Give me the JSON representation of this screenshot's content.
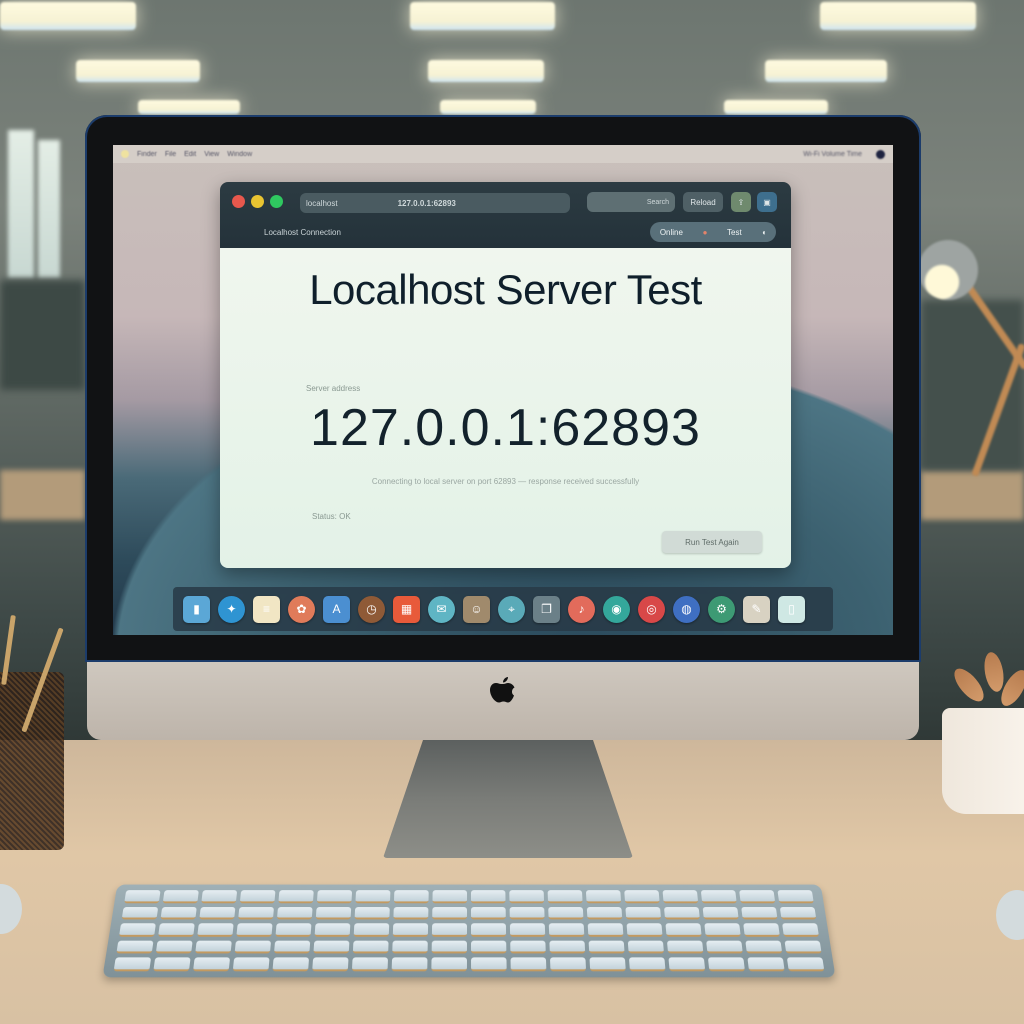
{
  "scene": {
    "description": "iMac on a wooden desk in an office, displaying a browser window"
  },
  "menubar": {
    "left_items": [
      "Finder",
      "File",
      "Edit",
      "View",
      "Window"
    ],
    "right_status": "Wi-Fi  Volume  Time"
  },
  "browser": {
    "traffic_lights": {
      "close": "#e8584d",
      "minimize": "#e9c431",
      "zoom": "#2fc860"
    },
    "url_prefix": "localhost",
    "url_path": "127.0.0.1:62893",
    "search_placeholder": "Search",
    "toolbar_button_label": "Reload",
    "tab_label": "Localhost Connection",
    "pill_text_left": "Online",
    "pill_text_mid": "Test",
    "page": {
      "title": "Localhost Server Test",
      "address_label": "Server address",
      "address": "127.0.0.1:62893",
      "description": "Connecting to local server on port 62893 — response received successfully",
      "status_label": "Status: OK",
      "action_button": "Run Test Again"
    }
  },
  "dock": {
    "icons": [
      {
        "name": "finder-icon",
        "glyph": "▮",
        "color": "#5ba7d6",
        "shape": "sq"
      },
      {
        "name": "safari-icon",
        "glyph": "✦",
        "color": "#2f94d2",
        "shape": "round"
      },
      {
        "name": "notes-icon",
        "glyph": "≡",
        "color": "#f1e6c4",
        "shape": "sq"
      },
      {
        "name": "photos-icon",
        "glyph": "✿",
        "color": "#e07b5a",
        "shape": "round"
      },
      {
        "name": "appstore-icon",
        "glyph": "A",
        "color": "#4b8fd1",
        "shape": "sq"
      },
      {
        "name": "clock-icon",
        "glyph": "◷",
        "color": "#8f5a37",
        "shape": "round"
      },
      {
        "name": "calendar-icon",
        "glyph": "▦",
        "color": "#e85a3a",
        "shape": "sq"
      },
      {
        "name": "messages-icon",
        "glyph": "✉",
        "color": "#5fb5c4",
        "shape": "round"
      },
      {
        "name": "contacts-icon",
        "glyph": "☺",
        "color": "#a08a6c",
        "shape": "sq"
      },
      {
        "name": "maps-icon",
        "glyph": "⌖",
        "color": "#5aaab8",
        "shape": "round"
      },
      {
        "name": "books-icon",
        "glyph": "❐",
        "color": "#6b8088",
        "shape": "sq"
      },
      {
        "name": "music-icon",
        "glyph": "♪",
        "color": "#e26b5b",
        "shape": "round"
      },
      {
        "name": "facetime-icon",
        "glyph": "◉",
        "color": "#34a79b",
        "shape": "round"
      },
      {
        "name": "news-icon",
        "glyph": "◎",
        "color": "#d84848",
        "shape": "round"
      },
      {
        "name": "podcasts-icon",
        "glyph": "◍",
        "color": "#3f6fc2",
        "shape": "round"
      },
      {
        "name": "settings-icon",
        "glyph": "⚙",
        "color": "#3d9a74",
        "shape": "round"
      },
      {
        "name": "textedit-icon",
        "glyph": "✎",
        "color": "#d8d2c2",
        "shape": "sq"
      },
      {
        "name": "trash-icon",
        "glyph": "▯",
        "color": "#cfe8e4",
        "shape": "sq"
      }
    ]
  }
}
